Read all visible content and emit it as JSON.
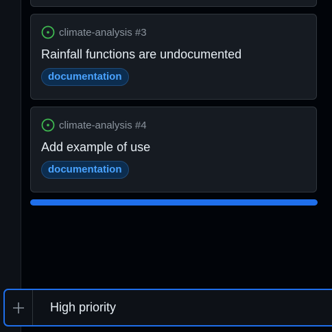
{
  "cards": [
    {
      "repo_ref": "climate-analysis #3",
      "title": "Rainfall functions are undocumented",
      "label": "documentation",
      "status_icon": "issue-open-icon"
    },
    {
      "repo_ref": "climate-analysis #4",
      "title": "Add example of use",
      "label": "documentation",
      "status_icon": "issue-open-icon"
    }
  ],
  "add_item": {
    "icon": "plus-icon",
    "value": "High priority"
  },
  "colors": {
    "accent": "#1f6feb",
    "issue_open": "#3fb950",
    "label_text": "#4aa3ff",
    "background": "#010409"
  }
}
